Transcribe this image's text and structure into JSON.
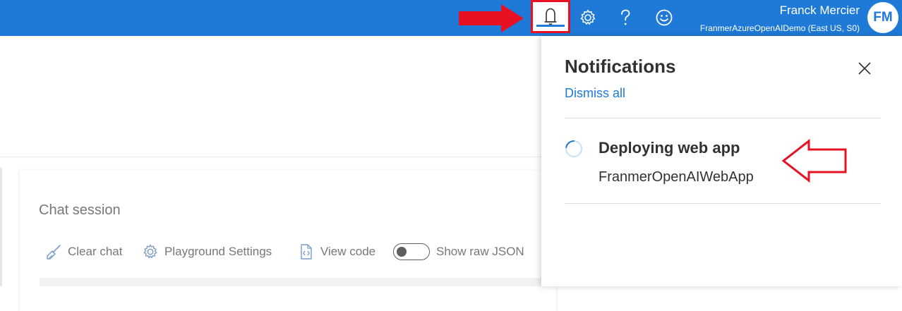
{
  "header": {
    "user_name": "Franck Mercier",
    "user_resource": "FranmerAzureOpenAIDemo (East US, S0)",
    "avatar_initials": "FM",
    "icons": [
      "bell-icon",
      "gear-icon",
      "help-icon",
      "feedback-smiley-icon"
    ],
    "accent_color": "#1e7ad6"
  },
  "chat": {
    "title": "Chat session",
    "toolbar": {
      "clear_chat": "Clear chat",
      "playground_settings": "Playground Settings",
      "view_code": "View code",
      "show_raw_json": "Show raw JSON"
    }
  },
  "notifications": {
    "title": "Notifications",
    "dismiss_all": "Dismiss all",
    "items": [
      {
        "title": "Deploying web app",
        "subtitle": "FranmerOpenAIWebApp",
        "status": "in-progress"
      }
    ]
  },
  "annotations": {
    "color": "#e81123"
  }
}
